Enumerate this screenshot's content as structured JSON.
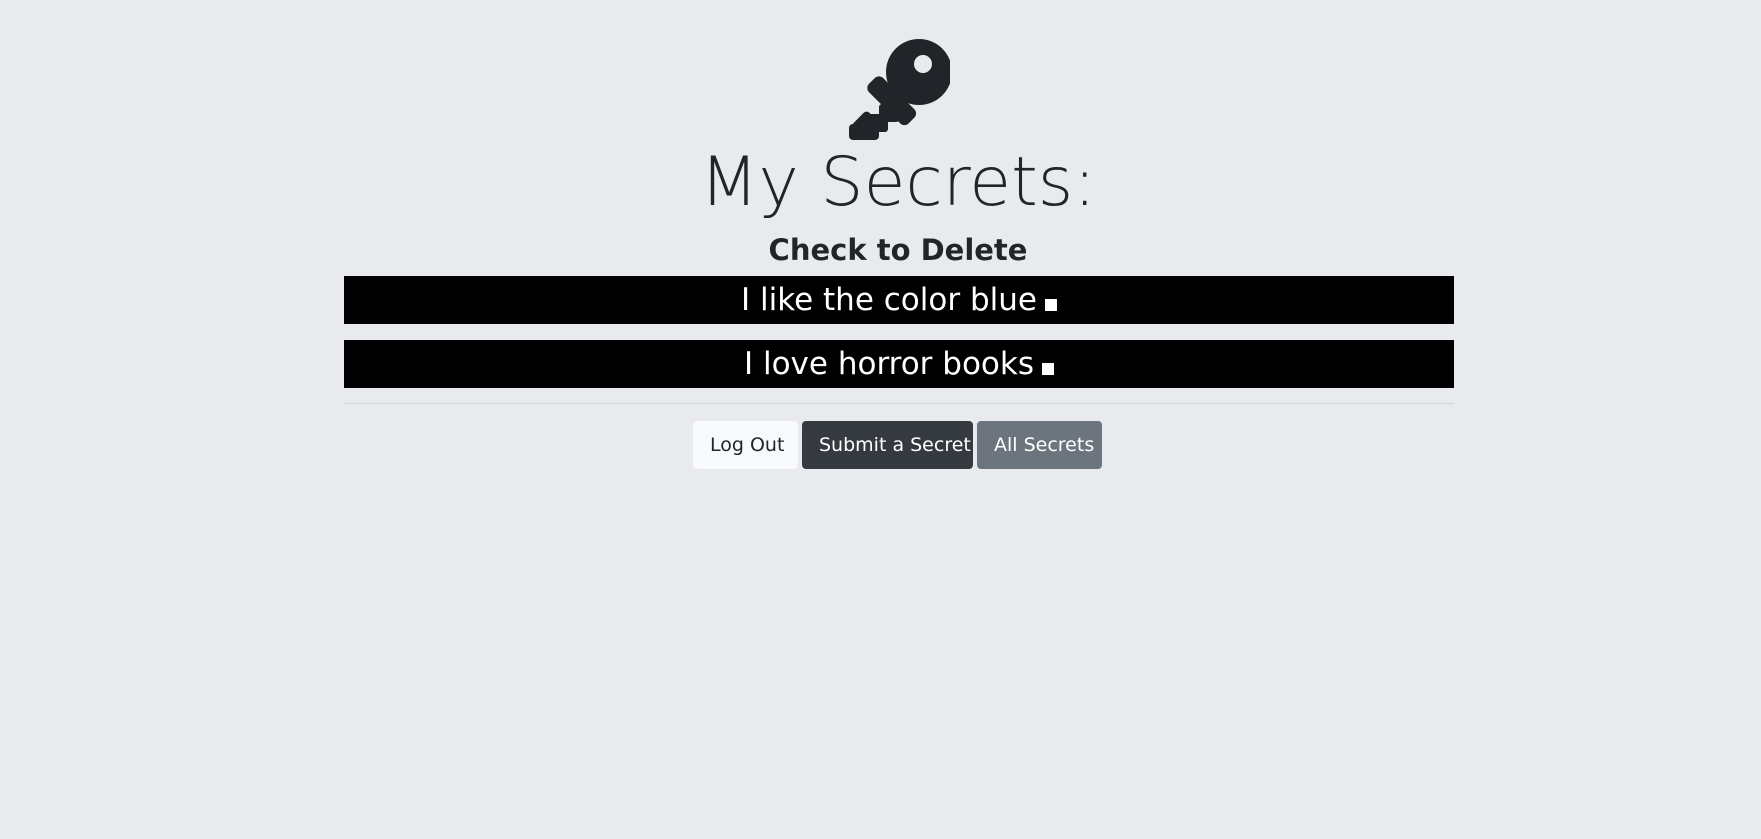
{
  "header": {
    "icon": "key-icon",
    "title": "My Secrets:",
    "subtitle": "Check to Delete"
  },
  "secrets": [
    {
      "text": "I like the color blue",
      "checked": false
    },
    {
      "text": "I love horror books",
      "checked": false
    }
  ],
  "actions": {
    "logout_label": "Log Out",
    "submit_label": "Submit a Secret",
    "all_label": "All Secrets"
  },
  "colors": {
    "background": "#e9eaed",
    "secret_row": "#000000",
    "text": "#212529",
    "btn_light": "#f8f9fa",
    "btn_dark": "#343a40",
    "btn_secondary": "#6c757d"
  }
}
